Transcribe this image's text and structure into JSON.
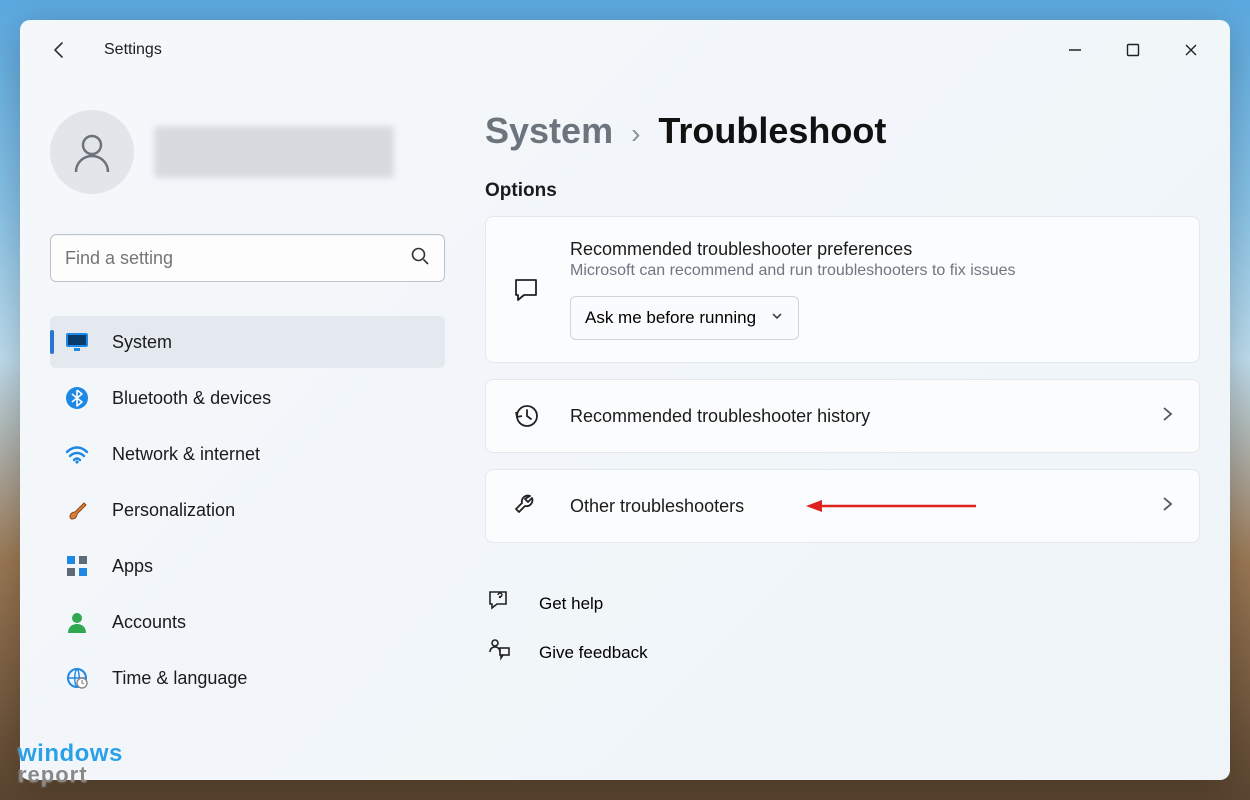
{
  "app_title": "Settings",
  "breadcrumb": {
    "parent": "System",
    "current": "Troubleshoot"
  },
  "search": {
    "placeholder": "Find a setting"
  },
  "nav": [
    {
      "label": "System",
      "icon": "display",
      "selected": true
    },
    {
      "label": "Bluetooth & devices",
      "icon": "bluetooth"
    },
    {
      "label": "Network & internet",
      "icon": "wifi"
    },
    {
      "label": "Personalization",
      "icon": "brush"
    },
    {
      "label": "Apps",
      "icon": "apps"
    },
    {
      "label": "Accounts",
      "icon": "person"
    },
    {
      "label": "Time & language",
      "icon": "globe-clock"
    }
  ],
  "options_heading": "Options",
  "cards": {
    "preferences": {
      "title": "Recommended troubleshooter preferences",
      "subtitle": "Microsoft can recommend and run troubleshooters to fix issues",
      "dropdown_value": "Ask me before running"
    },
    "history": {
      "title": "Recommended troubleshooter history"
    },
    "other": {
      "title": "Other troubleshooters"
    }
  },
  "help": {
    "get_help": "Get help",
    "feedback": "Give feedback"
  },
  "watermark": {
    "line1": "windows",
    "line2": "report"
  }
}
